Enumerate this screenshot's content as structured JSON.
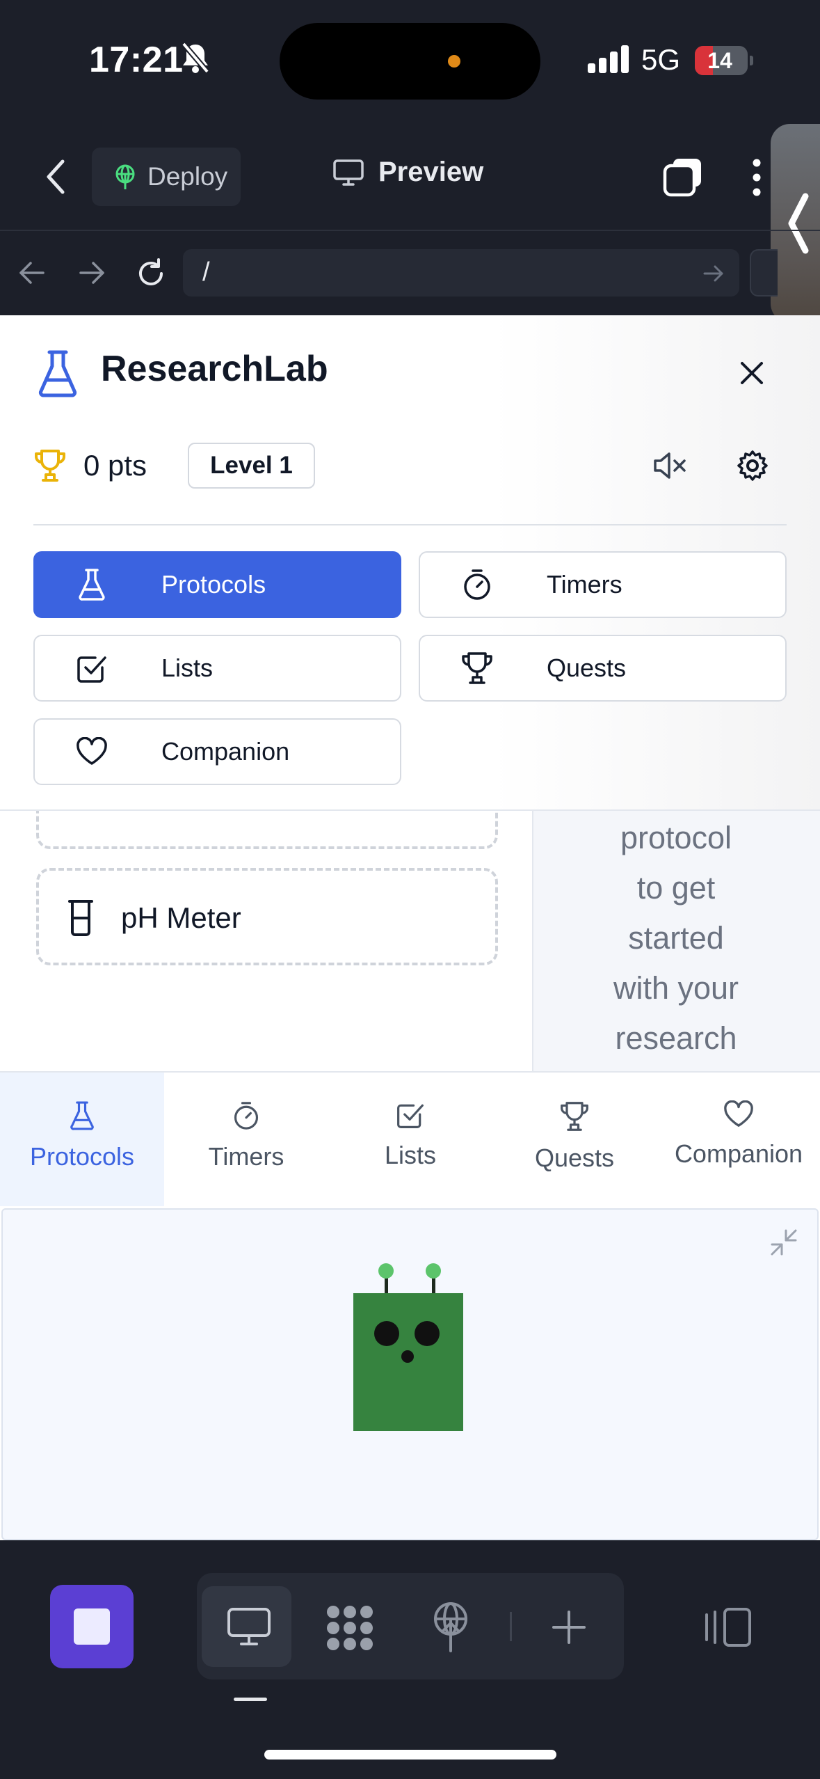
{
  "status_bar": {
    "time": "17:21",
    "network": "5G",
    "battery": "14",
    "battery_level": 0.14,
    "icons": [
      "bell-slash-icon",
      "signal-icon"
    ]
  },
  "editor_bar": {
    "deploy_label": "Deploy",
    "preview_label": "Preview",
    "icons": [
      "back-chevron-icon",
      "deploy-icon",
      "monitor-icon",
      "tabs-icon",
      "more-vertical-icon",
      "collapse-handle-icon"
    ]
  },
  "url_bar": {
    "path": "/",
    "icons": [
      "arrow-left-icon",
      "arrow-right-icon",
      "reload-icon",
      "go-arrow-icon"
    ]
  },
  "app": {
    "title": "ResearchLab",
    "points": "0 pts",
    "level": "Level 1",
    "accent_color": "#3b63e0",
    "nav": [
      {
        "label": "Protocols",
        "icon": "flask-icon",
        "active": true
      },
      {
        "label": "Timers",
        "icon": "timer-icon",
        "active": false
      },
      {
        "label": "Lists",
        "icon": "checkbox-icon",
        "active": false
      },
      {
        "label": "Quests",
        "icon": "trophy-icon",
        "active": false
      },
      {
        "label": "Companion",
        "icon": "heart-icon",
        "active": false
      }
    ],
    "equipment": [
      {
        "name": "pH Meter",
        "icon": "beaker-icon"
      }
    ],
    "side_hint": [
      "protocol",
      "to get",
      "started",
      "with your",
      "research"
    ]
  },
  "tabbar": {
    "tabs": [
      {
        "label": "Protocols",
        "icon": "flask-icon",
        "active": true
      },
      {
        "label": "Timers",
        "icon": "timer-icon",
        "active": false
      },
      {
        "label": "Lists",
        "icon": "checkbox-icon",
        "active": false
      },
      {
        "label": "Quests",
        "icon": "trophy-icon",
        "active": false
      },
      {
        "label": "Companion",
        "icon": "heart-icon",
        "active": false
      }
    ]
  },
  "companion": {
    "robot_color": "#36833f",
    "icons": [
      "minimize-icon"
    ]
  },
  "bottom_toolbar": {
    "icons": [
      "stop-icon",
      "monitor-icon",
      "apps-grid-icon",
      "deploy-icon",
      "plus-icon",
      "split-view-icon"
    ]
  }
}
